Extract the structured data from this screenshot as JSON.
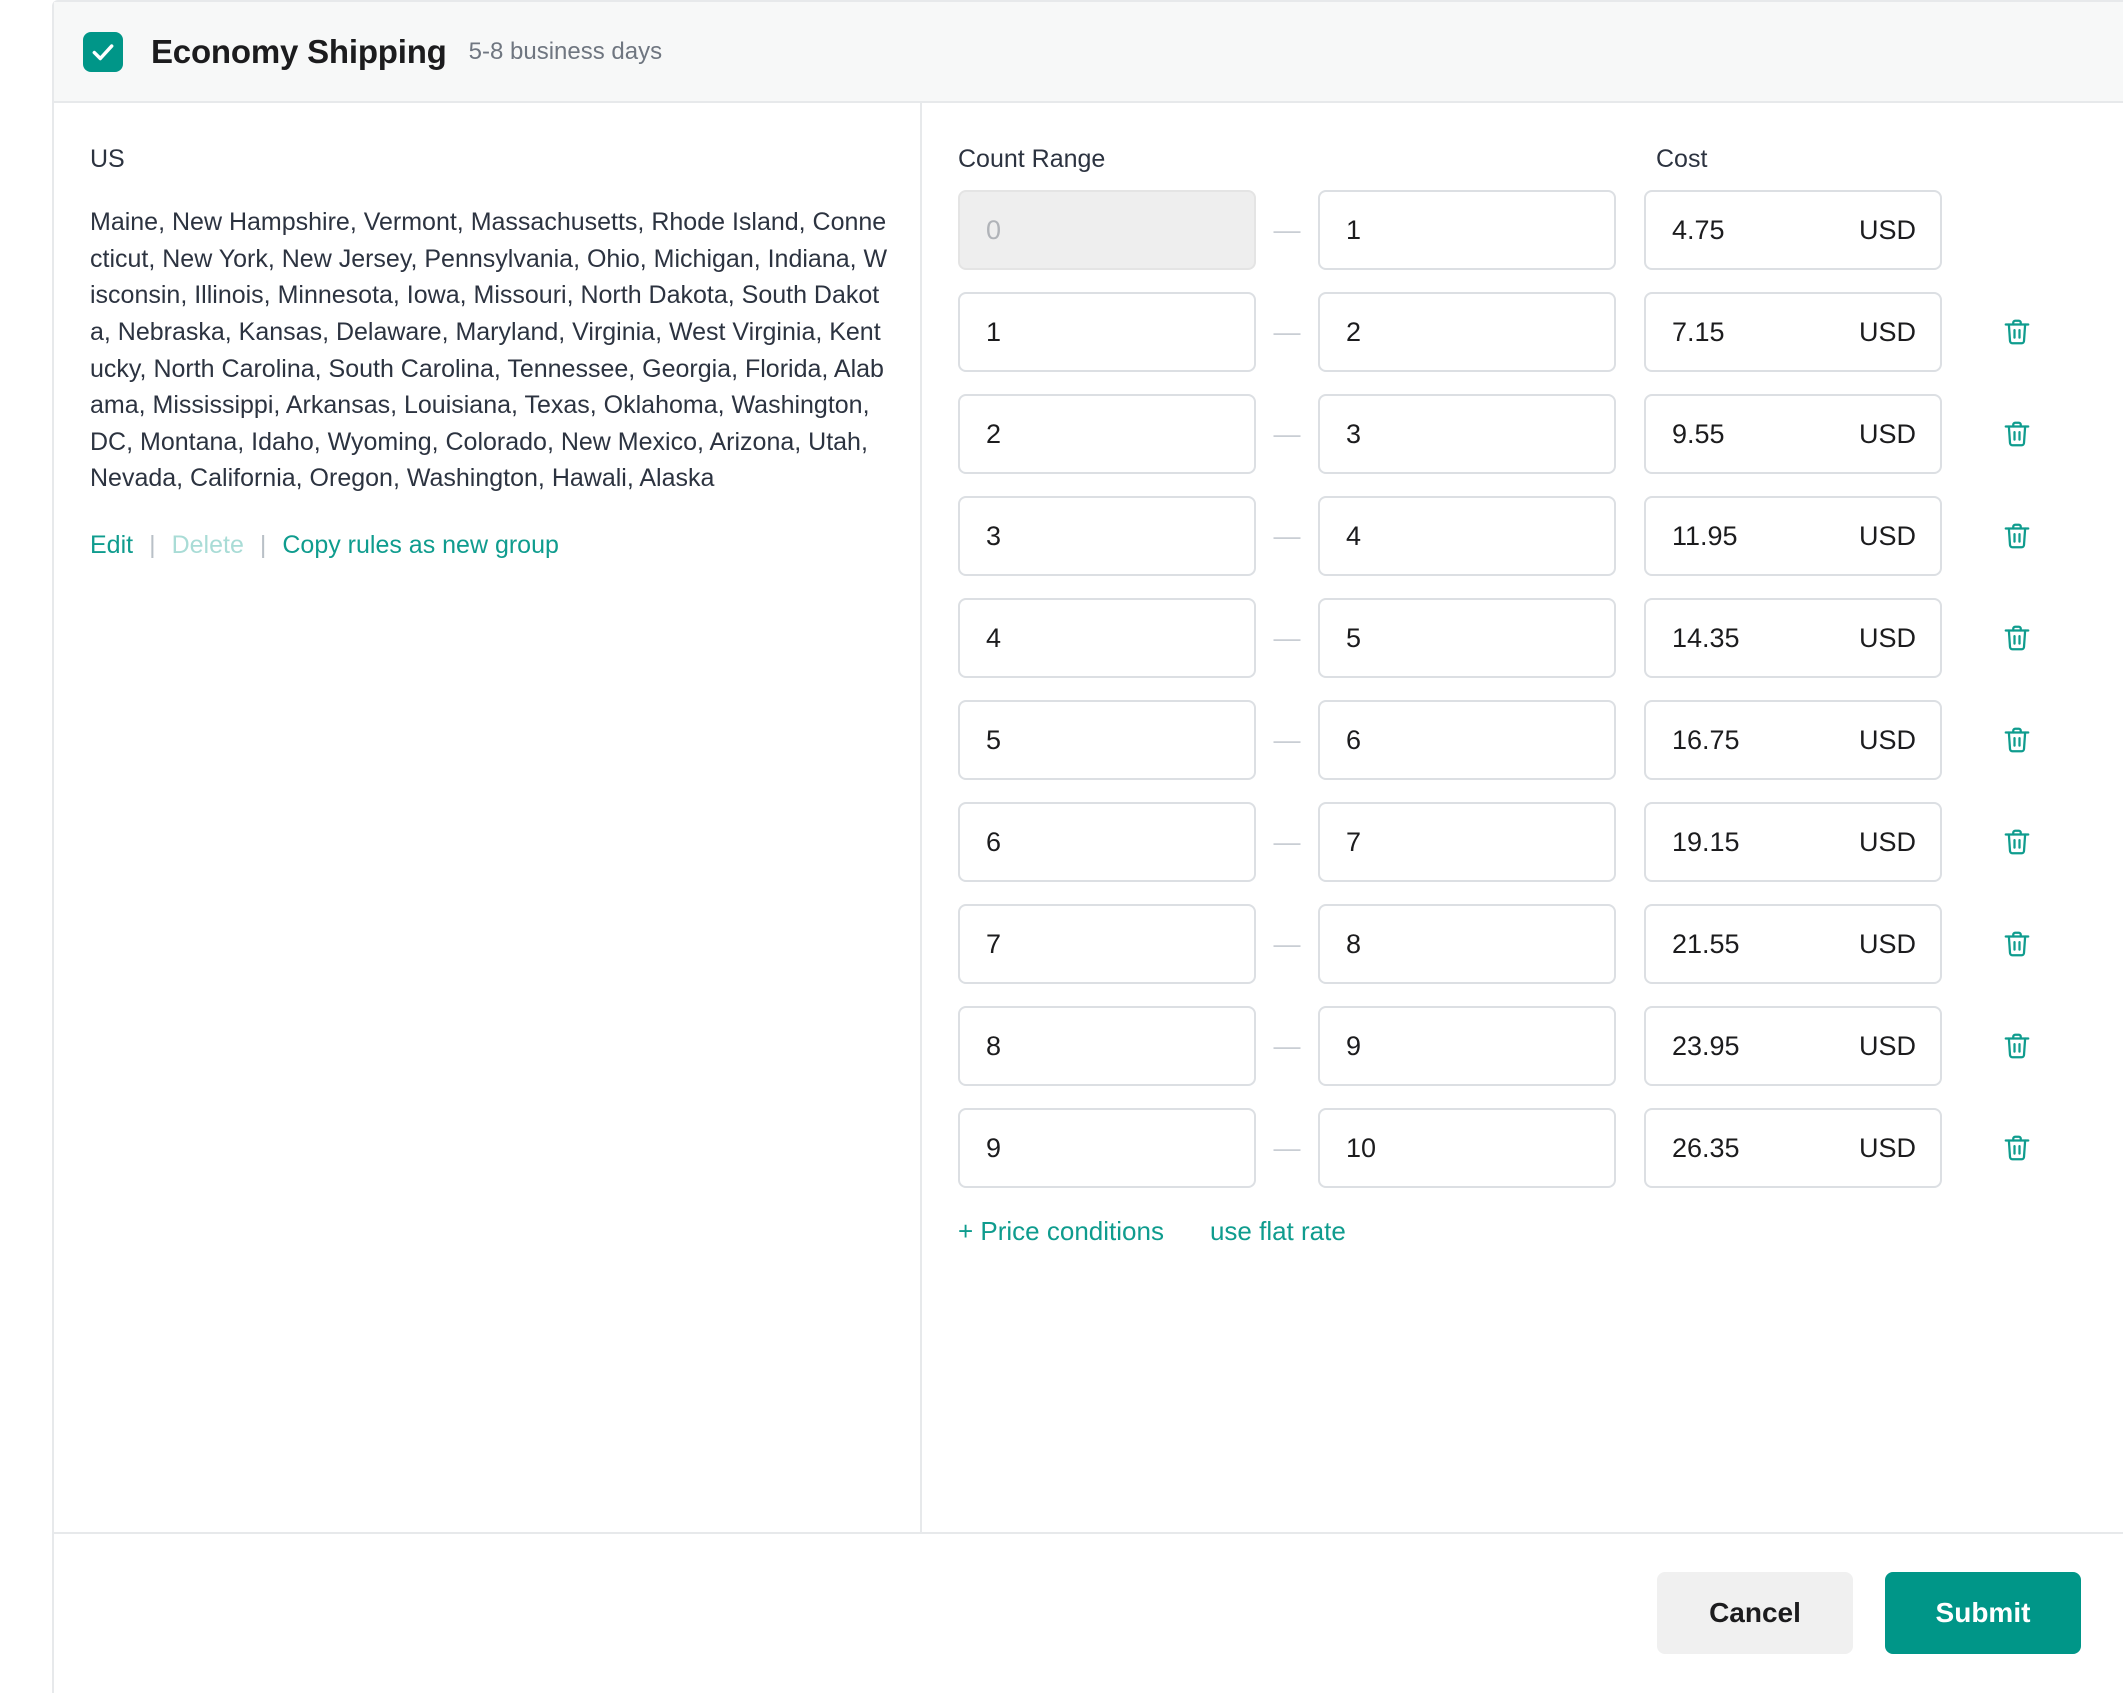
{
  "service": {
    "checkbox_checked": true,
    "checkbox_icon": "checkmark-icon",
    "title": "Economy Shipping",
    "subtitle": "5-8 business days"
  },
  "zone": {
    "country_label": "US",
    "states_text": "Maine, New Hampshire, Vermont, Massachusetts, Rhode Island, Connecticut, New York, New Jersey, Pennsylvania, Ohio, Michigan, Indiana, Wisconsin, Illinois, Minnesota, Iowa, Missouri, North Dakota, South Dakota, Nebraska, Kansas, Delaware, Maryland, Virginia, West Virginia, Kentucky, North Carolina, South Carolina, Tennessee, Georgia, Florida, Alabama, Mississippi, Arkansas, Louisiana, Texas, Oklahoma, Washington, DC, Montana, Idaho, Wyoming, Colorado, New Mexico, Arizona, Utah, Nevada, California, Oregon, Washington, Hawali, Alaska",
    "edit_label": "Edit",
    "delete_label": "Delete",
    "copy_label": "Copy rules as new group",
    "separator": "|"
  },
  "rates": {
    "header_count_range": "Count Range",
    "header_cost": "Cost",
    "range_dash": "—",
    "delete_icon": "trash-icon",
    "first_from_placeholder": "0",
    "rows": [
      {
        "from": "",
        "to": "1",
        "cost": "4.75",
        "currency": "USD",
        "from_disabled": true,
        "deletable": false
      },
      {
        "from": "1",
        "to": "2",
        "cost": "7.15",
        "currency": "USD",
        "from_disabled": false,
        "deletable": true
      },
      {
        "from": "2",
        "to": "3",
        "cost": "9.55",
        "currency": "USD",
        "from_disabled": false,
        "deletable": true
      },
      {
        "from": "3",
        "to": "4",
        "cost": "11.95",
        "currency": "USD",
        "from_disabled": false,
        "deletable": true
      },
      {
        "from": "4",
        "to": "5",
        "cost": "14.35",
        "currency": "USD",
        "from_disabled": false,
        "deletable": true
      },
      {
        "from": "5",
        "to": "6",
        "cost": "16.75",
        "currency": "USD",
        "from_disabled": false,
        "deletable": true
      },
      {
        "from": "6",
        "to": "7",
        "cost": "19.15",
        "currency": "USD",
        "from_disabled": false,
        "deletable": true
      },
      {
        "from": "7",
        "to": "8",
        "cost": "21.55",
        "currency": "USD",
        "from_disabled": false,
        "deletable": true
      },
      {
        "from": "8",
        "to": "9",
        "cost": "23.95",
        "currency": "USD",
        "from_disabled": false,
        "deletable": true
      },
      {
        "from": "9",
        "to": "10",
        "cost": "26.35",
        "currency": "USD",
        "from_disabled": false,
        "deletable": true
      }
    ],
    "price_conditions_label": "+ Price conditions",
    "flat_rate_label": "use flat rate"
  },
  "footer": {
    "cancel_label": "Cancel",
    "submit_label": "Submit"
  },
  "colors": {
    "accent": "#009688",
    "link": "#0f9c8e",
    "link_disabled": "#a9dcd6",
    "header_bg": "#f7f8f8",
    "border": "#e7e9eb",
    "field_border": "#dcdfe3",
    "disabled_field_bg": "#eeeeee",
    "text": "#2c3340",
    "muted_text": "#6f7680",
    "cancel_bg": "#f0f0f0"
  }
}
